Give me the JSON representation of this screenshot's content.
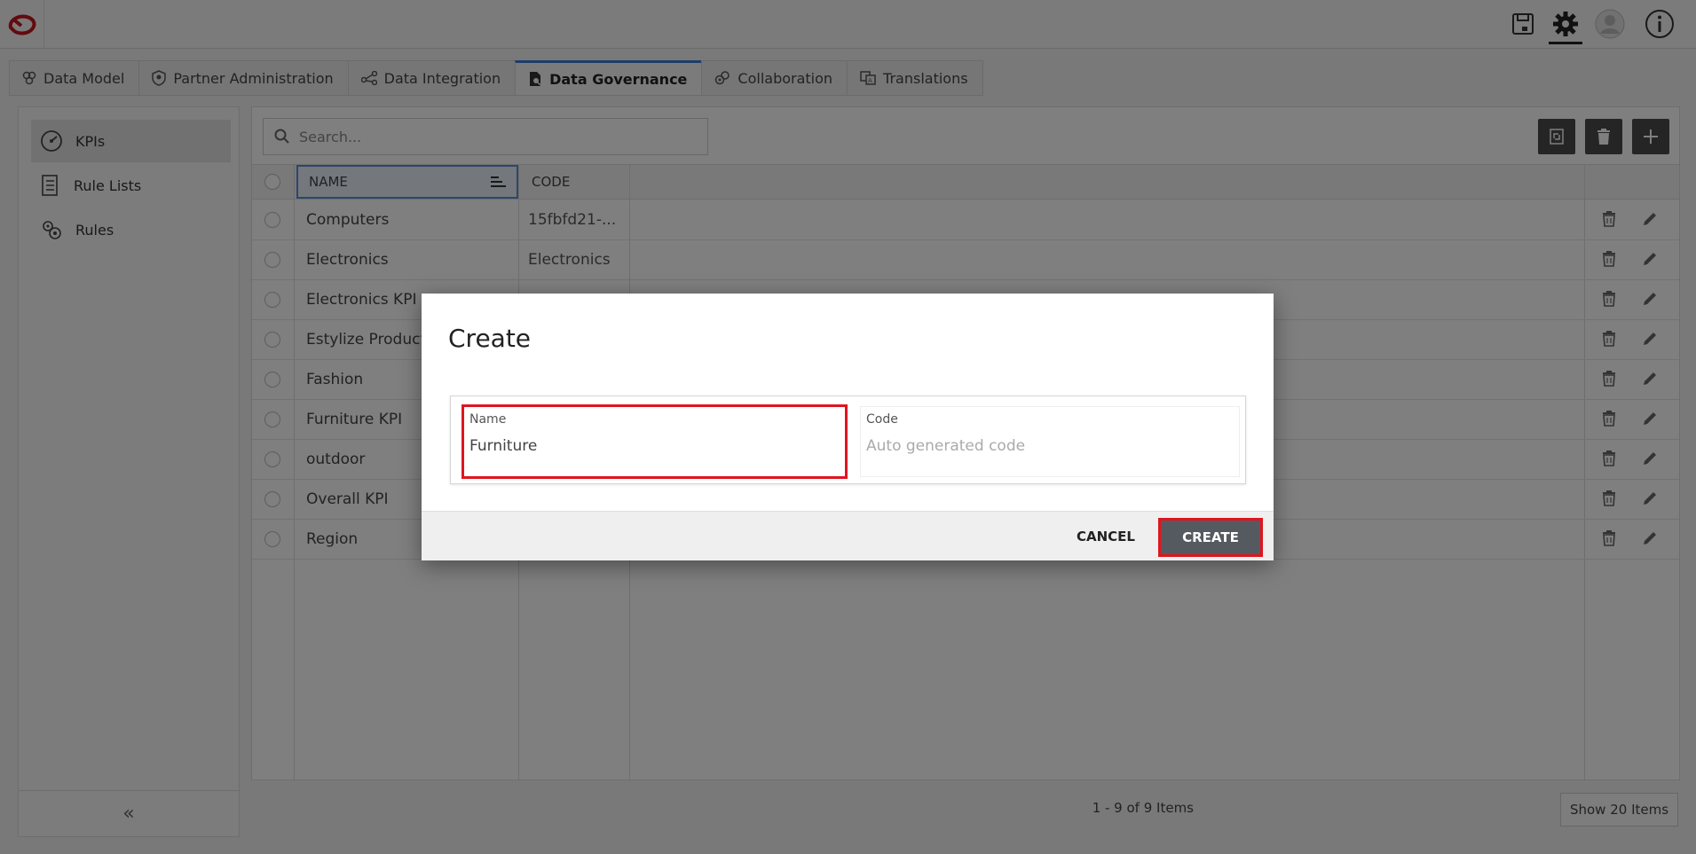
{
  "header": {
    "icons": [
      "logo",
      "save-icon",
      "gear-icon",
      "user-avatar-icon",
      "info-icon"
    ]
  },
  "tabs": [
    {
      "label": "Data Model",
      "icon": "data-model-icon",
      "active": false
    },
    {
      "label": "Partner Administration",
      "icon": "shield-icon",
      "active": false
    },
    {
      "label": "Data Integration",
      "icon": "integration-icon",
      "active": false
    },
    {
      "label": "Data Governance",
      "icon": "governance-icon",
      "active": true
    },
    {
      "label": "Collaboration",
      "icon": "collaboration-icon",
      "active": false
    },
    {
      "label": "Translations",
      "icon": "translate-icon",
      "active": false
    }
  ],
  "sidebar": {
    "items": [
      {
        "label": "KPIs",
        "icon": "gauge-icon",
        "active": true
      },
      {
        "label": "Rule Lists",
        "icon": "list-icon",
        "active": false
      },
      {
        "label": "Rules",
        "icon": "rules-icon",
        "active": false
      }
    ],
    "collapse_label": "«"
  },
  "search": {
    "placeholder": "Search..."
  },
  "table": {
    "columns": [
      "NAME",
      "CODE"
    ],
    "rows": [
      {
        "name": "Computers",
        "code": "15fbfd21-..."
      },
      {
        "name": "Electronics",
        "code": "Electronics"
      },
      {
        "name": "Electronics KPI",
        "code": ""
      },
      {
        "name": "Estylize Product",
        "code": ""
      },
      {
        "name": "Fashion",
        "code": ""
      },
      {
        "name": "Furniture KPI",
        "code": ""
      },
      {
        "name": "outdoor",
        "code": ""
      },
      {
        "name": "Overall KPI",
        "code": ""
      },
      {
        "name": "Region",
        "code": ""
      }
    ]
  },
  "pager": {
    "summary": "1 - 9 of 9 Items",
    "page_size": "Show 20 Items"
  },
  "modal": {
    "title": "Create",
    "name_label": "Name",
    "name_value": "Furniture",
    "code_label": "Code",
    "code_placeholder": "Auto generated code",
    "cancel_label": "CANCEL",
    "create_label": "CREATE"
  },
  "colors": {
    "accent": "#3a7bd5",
    "highlight": "#e0141e",
    "primary_button": "#555a60"
  }
}
